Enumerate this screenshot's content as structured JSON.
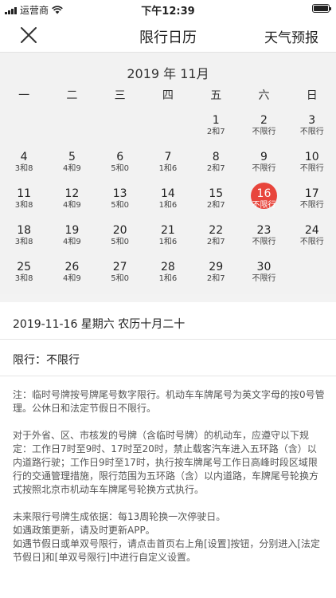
{
  "status_bar": {
    "carrier": "运营商",
    "time": "下午12:39"
  },
  "nav": {
    "title": "限行日历",
    "right_label": "天气预报"
  },
  "calendar": {
    "month_title": "2019 年 11月",
    "weekdays": [
      "一",
      "二",
      "三",
      "四",
      "五",
      "六",
      "日"
    ],
    "selected_day": "16",
    "highlight_color": "#e8453c",
    "rows": [
      [
        {
          "day": "",
          "rule": ""
        },
        {
          "day": "",
          "rule": ""
        },
        {
          "day": "",
          "rule": ""
        },
        {
          "day": "",
          "rule": ""
        },
        {
          "day": "1",
          "rule": "2和7"
        },
        {
          "day": "2",
          "rule": "不限行"
        },
        {
          "day": "3",
          "rule": "不限行"
        }
      ],
      [
        {
          "day": "4",
          "rule": "3和8"
        },
        {
          "day": "5",
          "rule": "4和9"
        },
        {
          "day": "6",
          "rule": "5和0"
        },
        {
          "day": "7",
          "rule": "1和6"
        },
        {
          "day": "8",
          "rule": "2和7"
        },
        {
          "day": "9",
          "rule": "不限行"
        },
        {
          "day": "10",
          "rule": "不限行"
        }
      ],
      [
        {
          "day": "11",
          "rule": "3和8"
        },
        {
          "day": "12",
          "rule": "4和9"
        },
        {
          "day": "13",
          "rule": "5和0"
        },
        {
          "day": "14",
          "rule": "1和6"
        },
        {
          "day": "15",
          "rule": "2和7"
        },
        {
          "day": "16",
          "rule": "不限行"
        },
        {
          "day": "17",
          "rule": "不限行"
        }
      ],
      [
        {
          "day": "18",
          "rule": "3和8"
        },
        {
          "day": "19",
          "rule": "4和9"
        },
        {
          "day": "20",
          "rule": "5和0"
        },
        {
          "day": "21",
          "rule": "1和6"
        },
        {
          "day": "22",
          "rule": "2和7"
        },
        {
          "day": "23",
          "rule": "不限行"
        },
        {
          "day": "24",
          "rule": "不限行"
        }
      ],
      [
        {
          "day": "25",
          "rule": "3和8"
        },
        {
          "day": "26",
          "rule": "4和9"
        },
        {
          "day": "27",
          "rule": "5和0"
        },
        {
          "day": "28",
          "rule": "1和6"
        },
        {
          "day": "29",
          "rule": "2和7"
        },
        {
          "day": "30",
          "rule": "不限行"
        },
        {
          "day": "",
          "rule": ""
        }
      ]
    ]
  },
  "detail": {
    "date_line": "2019-11-16 星期六 农历十月二十",
    "limit_line": "限行：不限行",
    "note1": "注：临时号牌按号牌尾号数字限行。机动车车牌尾号为英文字母的按0号管理。公休日和法定节假日不限行。",
    "note2": "对于外省、区、市核发的号牌（含临时号牌）的机动车，应遵守以下规定：工作日7时至9时、17时至20时，禁止载客汽车进入五环路（含）以内道路行驶；工作日9时至17时，执行按车牌尾号工作日高峰时段区域限行的交通管理措施，限行范围为五环路（含）以内道路，车牌尾号轮换方式按照北京市机动车车牌尾号轮换方式执行。",
    "note3_1": "未来限行号牌生成依据：每13周轮换一次停驶日。",
    "note3_2": "如遇政策更新，请及时更新APP。",
    "note3_3": "如遇节假日或单双号限行，请点击首页右上角[设置]按钮，分别进入[法定节假日]和[单双号限行]中进行自定义设置。"
  }
}
